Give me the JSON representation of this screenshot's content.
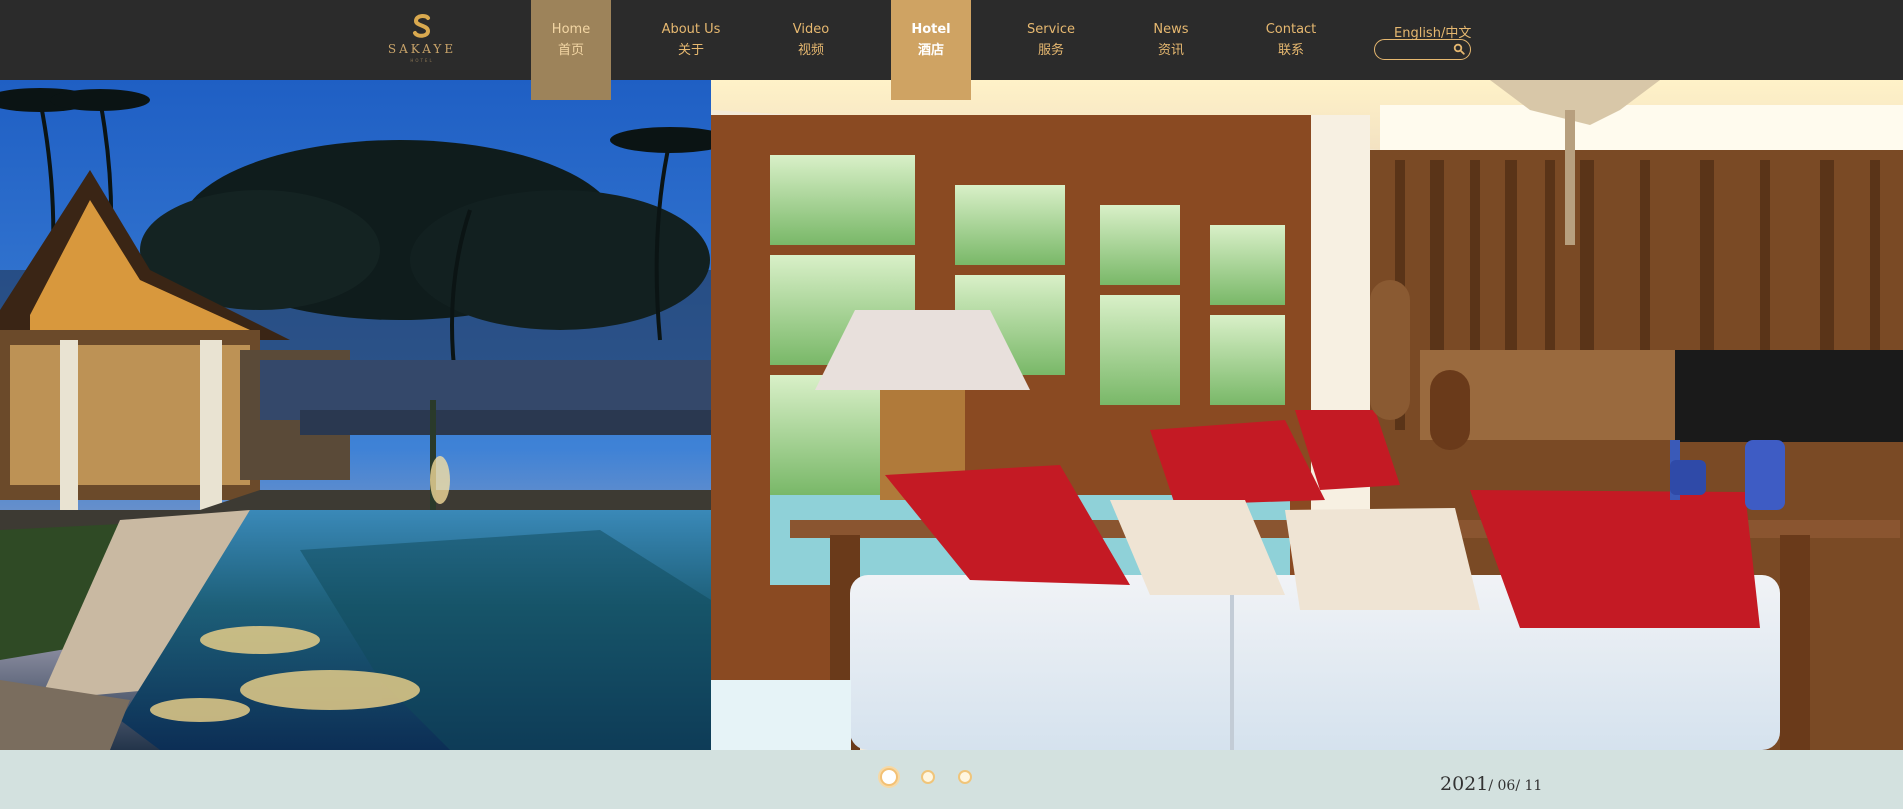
{
  "brand": {
    "name": "SAKAYE",
    "sub": "HOTEL"
  },
  "nav": [
    {
      "en": "Home",
      "cn": "首页"
    },
    {
      "en": "About Us",
      "cn": "关于"
    },
    {
      "en": "Video",
      "cn": "视频"
    },
    {
      "en": "Hotel",
      "cn": "酒店"
    },
    {
      "en": "Service",
      "cn": "服务"
    },
    {
      "en": "News",
      "cn": "资讯"
    },
    {
      "en": "Contact",
      "cn": "联系"
    }
  ],
  "lang": "English/中文",
  "search": {
    "placeholder": ""
  },
  "slider": {
    "dots": 3,
    "active": 1
  },
  "date": {
    "year": "2021",
    "month_day": "/ 06/ 11"
  },
  "colors": {
    "topbar": "#2b2b2b",
    "accent": "#e6b870",
    "active_nav": "#cfa363",
    "footer": "#d3e1df"
  }
}
